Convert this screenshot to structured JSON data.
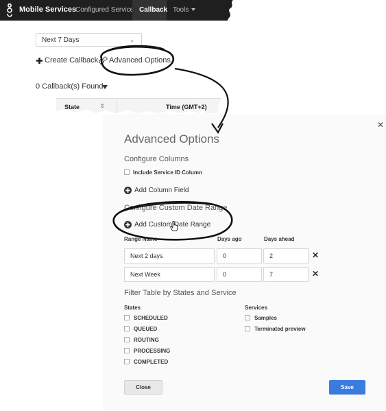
{
  "navbar": {
    "brand": "Mobile Services",
    "links": [
      "Configured Services",
      "Callback",
      "Tools"
    ]
  },
  "toolbar": {
    "range_select": "Next 7 Days",
    "create_callback": "Create Callback",
    "advanced_options": "Advanced Options",
    "found": "0 Callback(s) Found"
  },
  "table": {
    "headers": [
      "State",
      "Time (GMT+2)"
    ]
  },
  "dialog": {
    "title": "Advanced Options",
    "configure_columns": "Configure Columns",
    "include_service_id": "Include Service ID Column",
    "add_column_field": "Add Column Field",
    "configure_date_range": "Configure Custom Date Range",
    "add_custom_date_range": "Add Custom Date Range",
    "headers": {
      "range_name": "Range Name",
      "days_ago": "Days ago",
      "days_ahead": "Days ahead"
    },
    "ranges": [
      {
        "name": "Next 2 days",
        "ago": "0",
        "ahead": "2"
      },
      {
        "name": "Next Week",
        "ago": "0",
        "ahead": "7"
      }
    ],
    "filter_title": "Filter Table by States and Service",
    "states_label": "States",
    "states": [
      "SCHEDULED",
      "QUEUED",
      "ROUTING",
      "PROCESSING",
      "COMPLETED"
    ],
    "services_label": "Services",
    "services": [
      "Samples",
      "Terminated preview"
    ],
    "close_label": "Close",
    "save_label": "Save"
  },
  "colors": {
    "navbar": "#1f1f1f",
    "save_button": "#3a7be0",
    "dialog_bg": "#fafafa"
  },
  "icons": [
    "genesys-logo-icon",
    "plus-icon",
    "gears-icon",
    "caret-down-icon",
    "sort-icon",
    "close-icon",
    "circle-plus-icon",
    "delete-x-icon",
    "hand-cursor-icon"
  ]
}
